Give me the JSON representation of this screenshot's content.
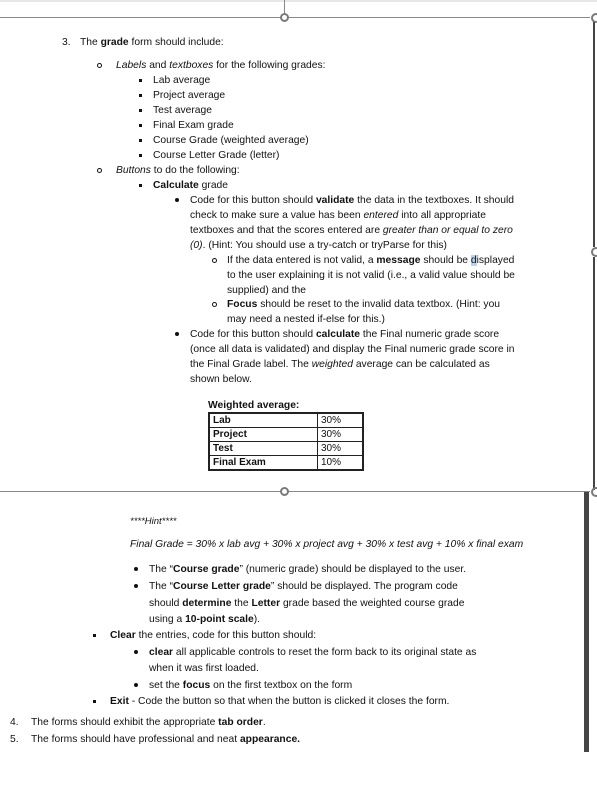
{
  "item3": {
    "number": "3.",
    "pre": "The ",
    "bold": "grade",
    "post": " form should include:",
    "labels_line": {
      "i1": "Labels",
      "m1": " and ",
      "i2": "textboxes",
      "post": " for the following grades:"
    },
    "grades": [
      "Lab average",
      "Project average",
      "Test average",
      "Final Exam grade",
      "Course Grade (weighted average)",
      "Course Letter Grade (letter)"
    ],
    "buttons_line": {
      "i1": "Buttons",
      "post": " to do the following:"
    },
    "calculate": {
      "bold": "Calculate",
      "post": " grade",
      "validate_lines": [
        [
          "Code for this button should ",
          "validate",
          " the data in the textboxes.  It should"
        ],
        [
          "check to make sure a value has been ",
          "entered",
          " into all appropriate"
        ],
        [
          "textboxes and that the scores entered are ",
          "greater than or equal to zero",
          ""
        ],
        [
          "(0)",
          ".  (Hint: You should use a try-catch or tryParse for this)"
        ]
      ],
      "message_lines": [
        [
          "If the data entered is not valid, a ",
          "message",
          " should be ",
          "d",
          "isplayed"
        ],
        [
          "to the user explaining it is not valid (i.e., a valid value should be"
        ],
        [
          "supplied) and the"
        ]
      ],
      "focus_lines": [
        [
          "Focus",
          " should be reset to the invalid data textbox.  (Hint: you"
        ],
        [
          "may need a nested if-else for this.)"
        ]
      ],
      "calc_lines": [
        [
          "Code for this button should ",
          "calculate",
          " the Final numeric grade score"
        ],
        [
          "(once all data is validated) and display the Final numeric grade score in"
        ],
        [
          "the Final Grade label.   The ",
          "weighted",
          " average can be calculated as"
        ],
        [
          "shown below."
        ]
      ],
      "weighted_title": "Weighted average:",
      "weights": [
        {
          "label": "Lab",
          "value": "30%"
        },
        {
          "label": "Project",
          "value": "30%"
        },
        {
          "label": "Test",
          "value": "30%"
        },
        {
          "label": "Final Exam",
          "value": "10%"
        }
      ],
      "hint_title": "****Hint****",
      "formula": "Final Grade = 30% x lab avg + 30% x project avg + 30% x test avg + 10% x final exam",
      "course_grade_line": [
        "The “",
        "Course grade",
        "” (numeric grade) should be displayed to the user."
      ],
      "letter_lines": [
        [
          "The “",
          "Course Letter grade",
          "” should be displayed.  The program code"
        ],
        [
          "should ",
          "determine",
          " the ",
          "Letter",
          " grade based the weighted course grade"
        ],
        [
          "using a ",
          "10-point scale",
          ")."
        ]
      ]
    },
    "clear": {
      "bold": "Clear",
      "post": " the entries, code for this button should:",
      "clear_lines": [
        [
          "",
          "clear",
          " all applicable controls to reset the form back to its original state as"
        ],
        [
          "when it was first loaded."
        ]
      ],
      "focus_line": [
        "set the ",
        "focus",
        " on the first textbox on the form"
      ]
    },
    "exit": {
      "bold": "Exit",
      "post": " - Code the button so that when the button is clicked it closes the form."
    }
  },
  "item4": {
    "number": "4.",
    "pre": "The forms should exhibit the appropriate ",
    "bold": "tab order",
    "post": "."
  },
  "item5": {
    "number": "5.",
    "pre": "The forms should have professional and neat ",
    "bold": "appearance."
  }
}
